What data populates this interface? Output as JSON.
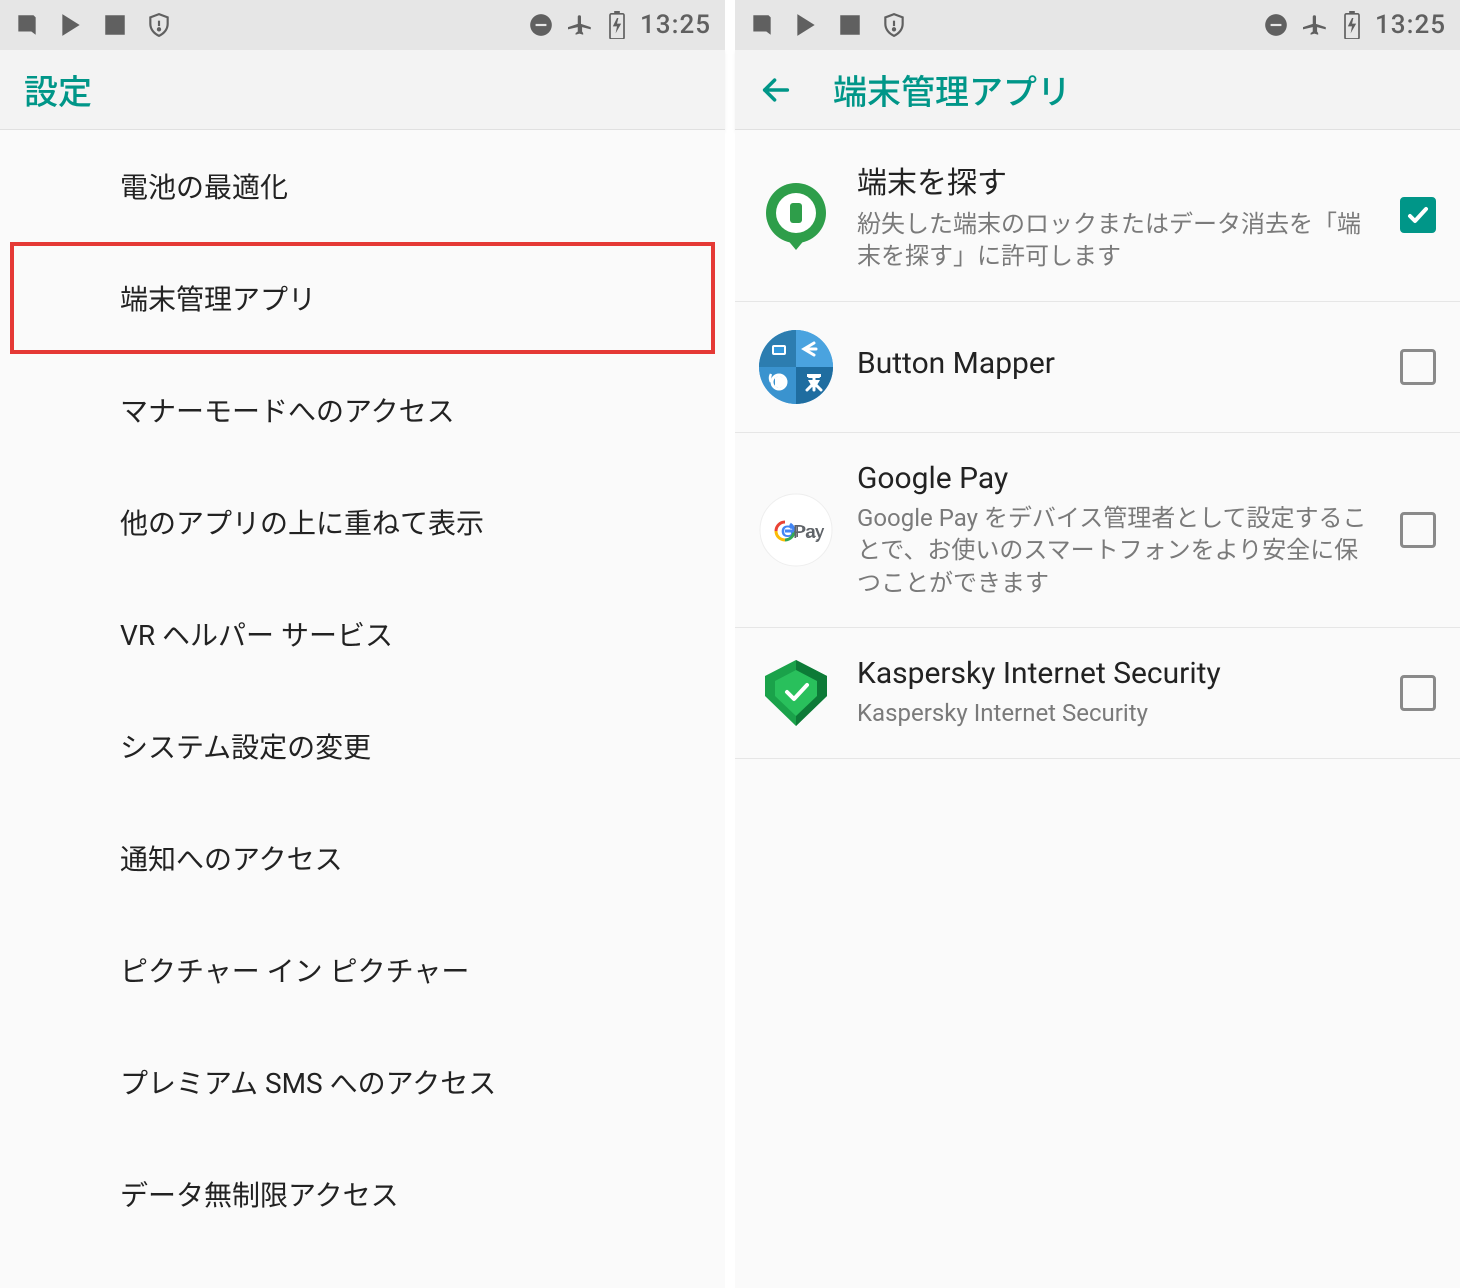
{
  "status": {
    "time": "13:25"
  },
  "left": {
    "title": "設定",
    "items": [
      {
        "label": "電池の最適化",
        "highlighted": false
      },
      {
        "label": "端末管理アプリ",
        "highlighted": true
      },
      {
        "label": "マナーモードへのアクセス",
        "highlighted": false
      },
      {
        "label": "他のアプリの上に重ねて表示",
        "highlighted": false
      },
      {
        "label": "VR ヘルパー サービス",
        "highlighted": false
      },
      {
        "label": "システム設定の変更",
        "highlighted": false
      },
      {
        "label": "通知へのアクセス",
        "highlighted": false
      },
      {
        "label": "ピクチャー イン ピクチャー",
        "highlighted": false
      },
      {
        "label": "プレミアム SMS へのアクセス",
        "highlighted": false
      },
      {
        "label": "データ無制限アクセス",
        "highlighted": false
      }
    ]
  },
  "right": {
    "title": "端末管理アプリ",
    "apps": [
      {
        "title": "端末を探す",
        "desc": "紛失した端末のロックまたはデータ消去を「端末を探す」に許可します",
        "checked": true,
        "iconKey": "find-device"
      },
      {
        "title": "Button Mapper",
        "desc": "",
        "checked": false,
        "iconKey": "button-mapper"
      },
      {
        "title": "Google Pay",
        "desc": "Google Pay をデバイス管理者として設定することで、お使いのスマートフォンをより安全に保つことができます",
        "checked": false,
        "iconKey": "gpay"
      },
      {
        "title": "Kaspersky Internet Security",
        "desc": "Kaspersky Internet Security",
        "checked": false,
        "iconKey": "kaspersky"
      }
    ]
  }
}
